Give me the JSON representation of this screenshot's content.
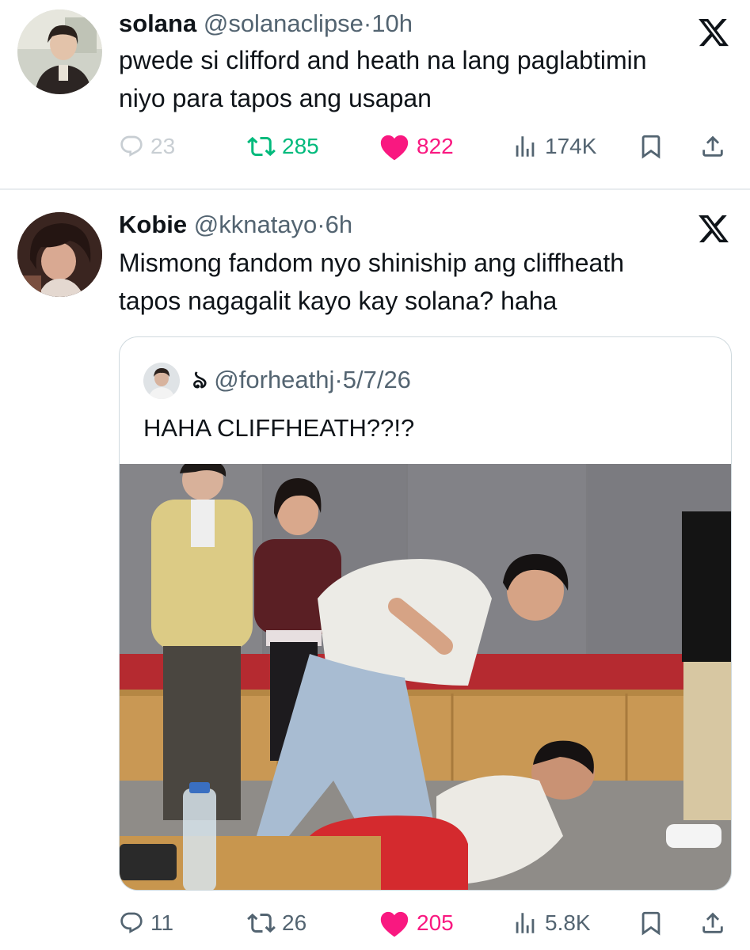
{
  "tweets": [
    {
      "name": "solana",
      "handle": "@solanaclipse",
      "separator": "·",
      "time": "10h",
      "text_lines": [
        "pwede si clifford and heath na lang paglabtimin",
        "niyo para tapos ang usapan"
      ],
      "replies": "23",
      "retweets": "285",
      "likes": "822",
      "views": "174K",
      "icons": [
        "reply-icon",
        "retweet-icon",
        "heart-icon",
        "views-icon",
        "bookmark-icon",
        "share-icon",
        "x-logo-icon"
      ]
    },
    {
      "name": "Kobie",
      "handle": "@kknatayo",
      "separator": "·",
      "time": "6h",
      "text_lines": [
        "Mismong fandom nyo shiniship ang cliffheath",
        "tapos nagagalit kayo kay solana? haha"
      ],
      "replies": "11",
      "retweets": "26",
      "likes": "205",
      "views": "5.8K",
      "quote": {
        "display_glyph": "ঌ",
        "handle": "@forheathj",
        "separator": "·",
        "date": "5/7/26",
        "text": "HAHA CLIFFHEATH??!?"
      }
    }
  ],
  "colors": {
    "text": "#0f1419",
    "secondary": "#536471",
    "retweet_green": "#00ba7c",
    "like_pink": "#f91880",
    "divider": "#e8ecef",
    "quote_border": "#cfd9de"
  }
}
